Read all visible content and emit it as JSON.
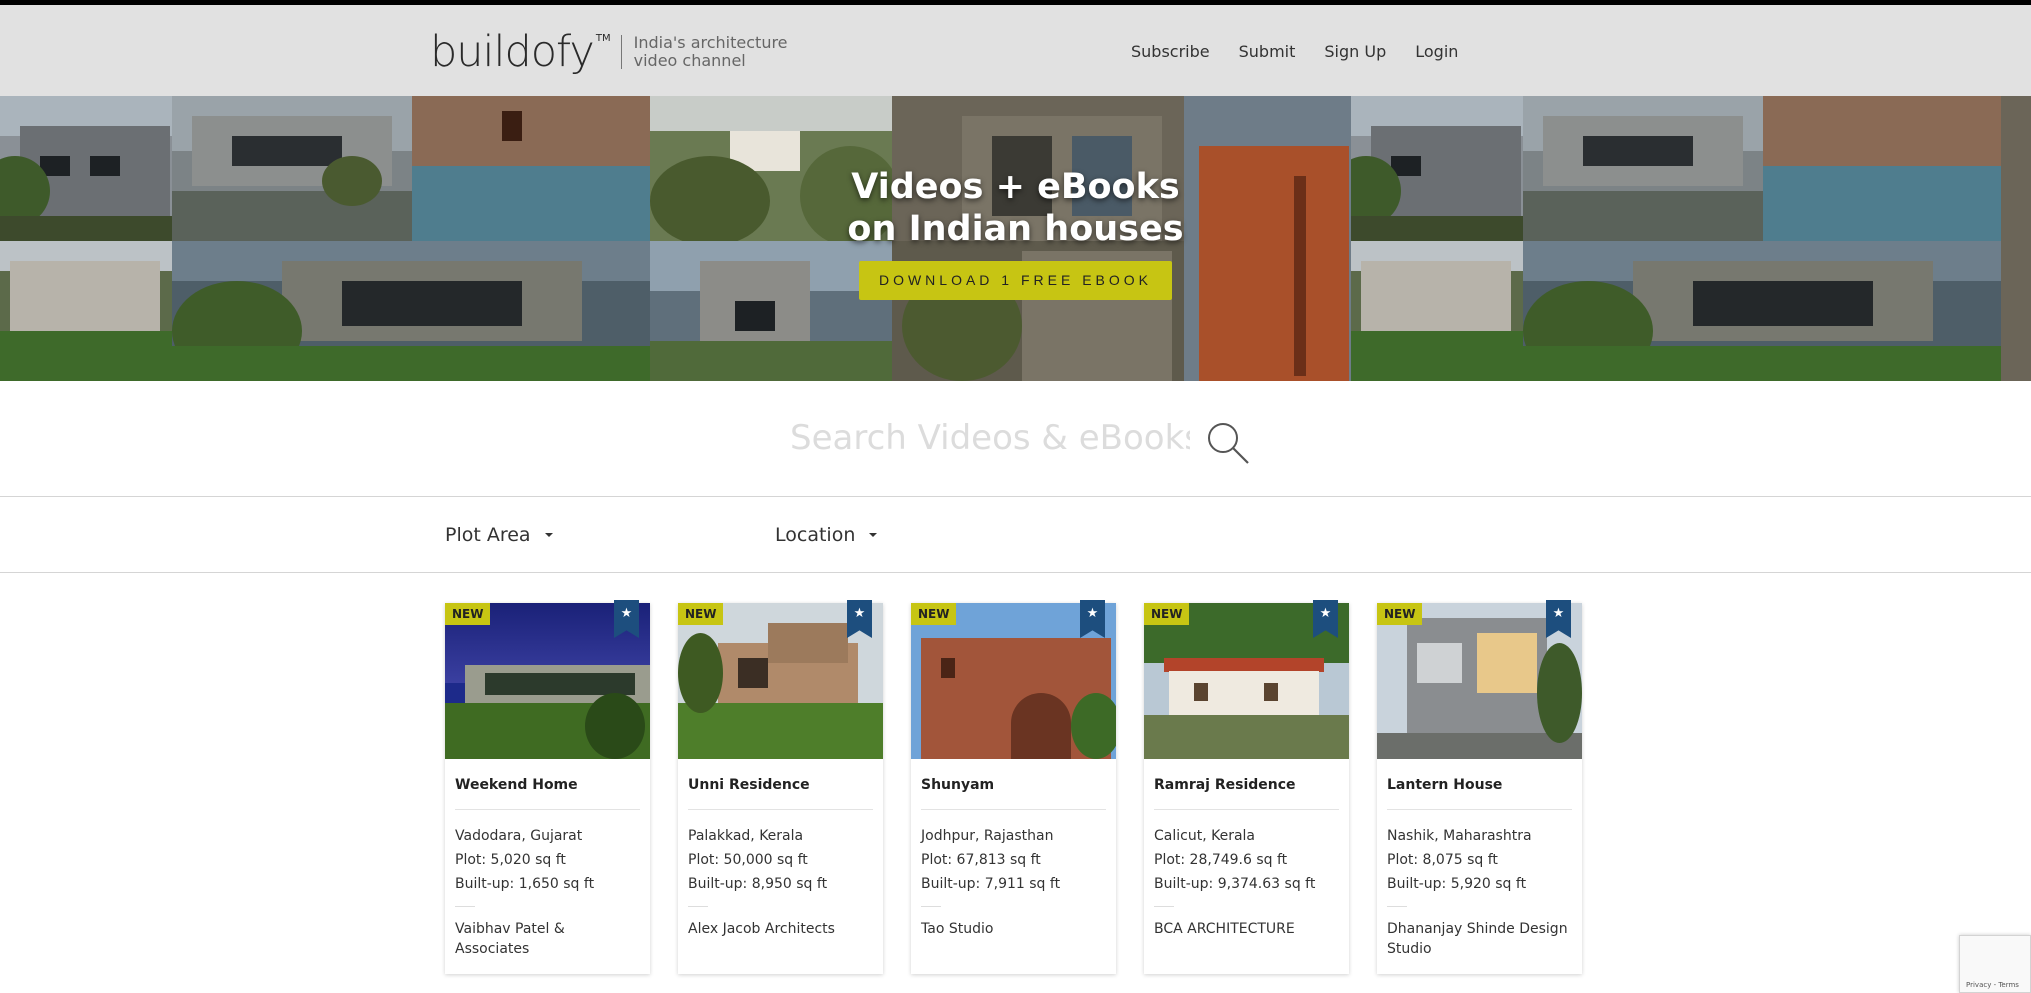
{
  "header": {
    "logo_text": "buildofy",
    "logo_tm": "TM",
    "tagline_1": "India's architecture",
    "tagline_2": "video channel",
    "nav": [
      "Subscribe",
      "Submit",
      "Sign Up",
      "Login"
    ]
  },
  "hero": {
    "title_line_1": "Videos + eBooks",
    "title_line_2": "on Indian houses",
    "button_label": "DOWNLOAD 1 FREE EBOOK"
  },
  "search": {
    "placeholder": "Search Videos & eBooks",
    "icon": "search-icon"
  },
  "filters": {
    "plot_area_label": "Plot Area",
    "location_label": "Location"
  },
  "cards": [
    {
      "badge": "NEW",
      "title": "Weekend Home",
      "location": "Vadodara, Gujarat",
      "plot": "Plot: 5,020 sq ft",
      "builtup": "Built-up: 1,650 sq ft",
      "architect": "Vaibhav Patel & Associates"
    },
    {
      "badge": "NEW",
      "title": "Unni Residence",
      "location": "Palakkad, Kerala",
      "plot": "Plot: 50,000 sq ft",
      "builtup": "Built-up: 8,950 sq ft",
      "architect": "Alex Jacob Architects"
    },
    {
      "badge": "NEW",
      "title": "Shunyam",
      "location": "Jodhpur, Rajasthan",
      "plot": "Plot: 67,813 sq ft",
      "builtup": "Built-up: 7,911 sq ft",
      "architect": "Tao Studio"
    },
    {
      "badge": "NEW",
      "title": "Ramraj Residence",
      "location": "Calicut, Kerala",
      "plot": "Plot: 28,749.6 sq ft",
      "builtup": "Built-up: 9,374.63 sq ft",
      "architect": "BCA ARCHITECTURE"
    },
    {
      "badge": "NEW",
      "title": "Lantern House",
      "location": "Nashik, Maharashtra",
      "plot": "Plot: 8,075 sq ft",
      "builtup": "Built-up: 5,920 sq ft",
      "architect": "Dhananjay Shinde Design Studio"
    }
  ],
  "recaptcha": {
    "text": "Privacy - Terms"
  },
  "colors": {
    "accent": "#c7c513",
    "ribbon": "#1d4e7e",
    "header_bg": "#e1e1e1"
  }
}
